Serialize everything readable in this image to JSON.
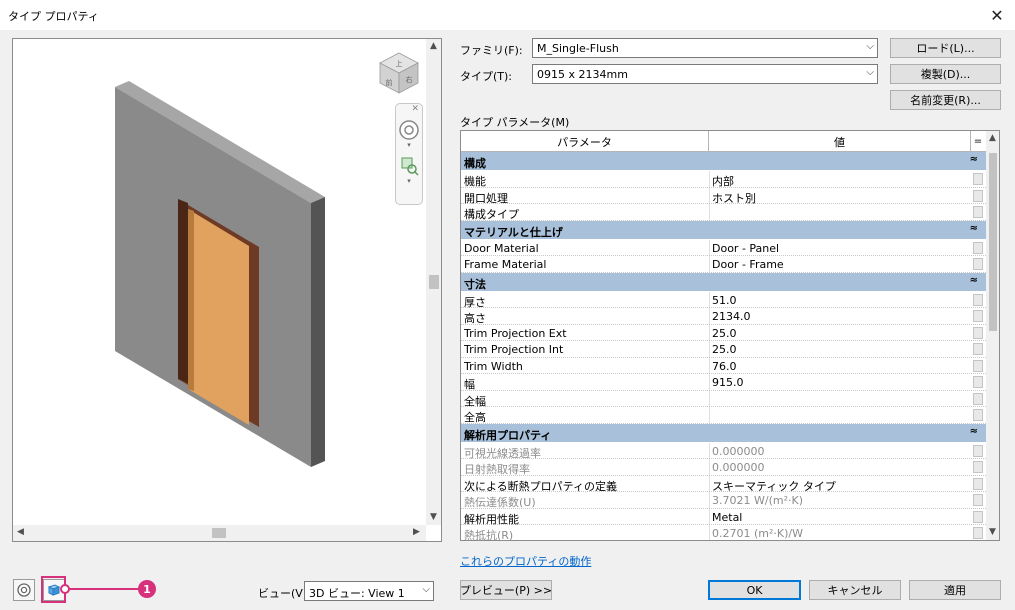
{
  "window": {
    "title": "タイプ プロパティ"
  },
  "family": {
    "label": "ファミリ(F):",
    "value": "M_Single-Flush"
  },
  "type": {
    "label": "タイプ(T):",
    "value": "0915 x 2134mm"
  },
  "buttons": {
    "load": "ロード(L)...",
    "duplicate": "複製(D)...",
    "rename": "名前変更(R)...",
    "preview": "プレビュー(P) >>",
    "ok": "OK",
    "cancel": "キャンセル",
    "apply": "適用"
  },
  "params_label": "タイプ パラメータ(M)",
  "grid": {
    "header_param": "パラメータ",
    "header_value": "値",
    "header_menu": "=",
    "groups": [
      {
        "name": "構成",
        "collapse": "≈",
        "rows": [
          {
            "param": "機能",
            "value": "内部"
          },
          {
            "param": "開口処理",
            "value": "ホスト別"
          },
          {
            "param": "構成タイプ",
            "value": ""
          }
        ]
      },
      {
        "name": "マテリアルと仕上げ",
        "collapse": "≈",
        "rows": [
          {
            "param": "Door Material",
            "value": "Door - Panel"
          },
          {
            "param": "Frame Material",
            "value": "Door - Frame"
          }
        ]
      },
      {
        "name": "寸法",
        "collapse": "≈",
        "rows": [
          {
            "param": "厚さ",
            "value": "51.0"
          },
          {
            "param": "高さ",
            "value": "2134.0"
          },
          {
            "param": "Trim Projection Ext",
            "value": "25.0"
          },
          {
            "param": "Trim Projection Int",
            "value": "25.0"
          },
          {
            "param": "Trim Width",
            "value": "76.0"
          },
          {
            "param": "幅",
            "value": "915.0"
          },
          {
            "param": "全幅",
            "value": ""
          },
          {
            "param": "全高",
            "value": ""
          }
        ]
      },
      {
        "name": "解析用プロパティ",
        "collapse": "≈",
        "rows": [
          {
            "param": "可視光線透過率",
            "value": "0.000000",
            "dim": true
          },
          {
            "param": "日射熱取得率",
            "value": "0.000000",
            "dim": true
          },
          {
            "param": "次による断熱プロパティの定義",
            "value": "スキーマティック タイプ"
          },
          {
            "param": "熱伝達係数(U)",
            "value": "3.7021 W/(m²·K)",
            "dim": true
          },
          {
            "param": "解析用性能",
            "value": "Metal"
          },
          {
            "param": "熱抵抗(R)",
            "value": "0.2701 (m²·K)/W",
            "dim": true
          }
        ]
      }
    ]
  },
  "link": "これらのプロパティの動作",
  "view": {
    "label": "ビュー(V):",
    "value": "3D ビュー: View 1"
  },
  "viewcube": {
    "face_top": "上",
    "face_front": "前",
    "face_right": "右"
  },
  "callout": "1",
  "icons": {
    "close": "close-icon",
    "steering_wheel": "steering-wheel-icon",
    "cube": "view-cube-icon"
  },
  "colors": {
    "group_header": "#a8c0da",
    "door_panel": "#e0a25e",
    "door_frame": "#6e3a24",
    "wall_front": "#8a8a8a",
    "wall_side": "#545454",
    "callout": "#d6317a"
  }
}
